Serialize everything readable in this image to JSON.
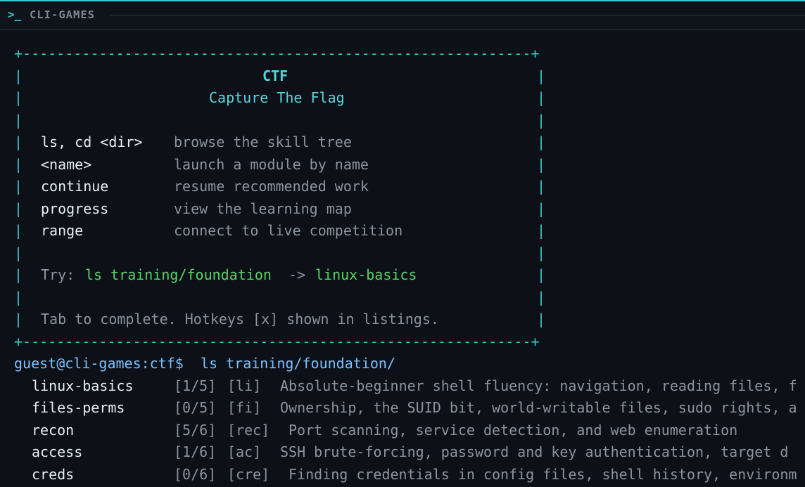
{
  "window": {
    "prompt_symbol": ">_",
    "title": "CLI-GAMES"
  },
  "banner": {
    "border_top": "+------------------------------------------------------------+",
    "border_bottom": "+------------------------------------------------------------+",
    "pipe": "|",
    "heading": "CTF",
    "subheading": "Capture The Flag",
    "commands": [
      {
        "cmd": "ls, cd <dir>",
        "desc": "browse the skill tree"
      },
      {
        "cmd": "<name>",
        "desc": "launch a module by name"
      },
      {
        "cmd": "continue",
        "desc": "resume recommended work"
      },
      {
        "cmd": "progress",
        "desc": "view the learning map"
      },
      {
        "cmd": "range",
        "desc": "connect to live competition"
      }
    ],
    "try_label": "Try:",
    "try_cmd": "ls training/foundation",
    "try_arrow": "->",
    "try_target": "linux-basics",
    "hint": "Tab to complete. Hotkeys [x] shown in listings."
  },
  "prompt": {
    "user_host": "guest@cli-games:ctf$",
    "command": "ls training/foundation/"
  },
  "listing": [
    {
      "name": "linux-basics",
      "progress": "[1/5]",
      "hotkey": "[li]",
      "description": "Absolute-beginner shell fluency: navigation, reading files, f"
    },
    {
      "name": "files-perms",
      "progress": "[0/5]",
      "hotkey": "[fi]",
      "description": "Ownership, the SUID bit, world-writable files, sudo rights, a"
    },
    {
      "name": "recon",
      "progress": "[5/6]",
      "hotkey": "[rec]",
      "description": "Port scanning, service detection, and web enumeration"
    },
    {
      "name": "access",
      "progress": "[1/6]",
      "hotkey": "[ac]",
      "description": "SSH brute-forcing, password and key authentication, target d"
    },
    {
      "name": "creds",
      "progress": "[0/6]",
      "hotkey": "[cre]",
      "description": "Finding credentials in config files, shell history, environm"
    }
  ]
}
